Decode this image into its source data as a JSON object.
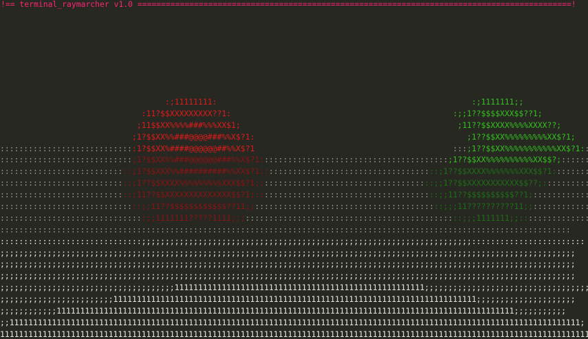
{
  "window": {
    "title": "!== terminal_raymarcher v1.0 ============================================================================================!"
  },
  "colors": {
    "background": "#272822",
    "title": "#f92672",
    "red_sphere": "#e01b1b",
    "red_sphere_dark": "#8a1414",
    "green_sphere": "#34c21e",
    "green_sphere_dark": "#1f6f16",
    "floor": "#e8e8e0",
    "floor_dim": "#9a9a90"
  },
  "frame": {
    "rows": [
      [
        {
          "t": "                                   :;11111111:",
          "c": "red_sphere"
        },
        {
          "t": "                                                      :;1111111;;",
          "c": "green_sphere"
        }
      ],
      [
        {
          "t": "                              :11?$$XXXXXXXXX??1:",
          "c": "red_sphere"
        },
        {
          "t": "                                               :;;1??$$$$XXX$$??1;",
          "c": "green_sphere"
        }
      ],
      [
        {
          "t": "                             ;11$$XX%%%%###%%%XX$1;",
          "c": "red_sphere"
        },
        {
          "t": "                                              ;11??$$XXXX%%%%XXXX??;",
          "c": "green_sphere"
        }
      ],
      [
        {
          "t": "                            ;1?$$XX%%###@@@@###%%X$?1:",
          "c": "red_sphere"
        },
        {
          "t": "                                             ;1??$$XX%%%%%%%%%XX$?1;",
          "c": "green_sphere"
        }
      ],
      [
        {
          "t": "::::::::::::::::::::::::::::",
          "c": "floor_dim"
        },
        {
          "t": ":1?$$XX%####@@@@@@##%%X$?1",
          "c": "red_sphere"
        },
        {
          "t": "                                          :::",
          "c": "floor_dim"
        },
        {
          "t": ";1??$$XX%%%%%%%%%%%XX$?1:",
          "c": "green_sphere"
        },
        {
          "t": ":::::::::::::::::::::::",
          "c": "floor_dim"
        }
      ],
      [
        {
          "t": "::::::::::::::::::::::::::::",
          "c": "floor_dim"
        },
        {
          "t": ";1?$$XX%%###@@@@@@###%%X$?1:",
          "c": "red_sphere_dark"
        },
        {
          "t": ":::::::::::::::::::::::::::::::::::::::",
          "c": "floor_dim"
        },
        {
          "t": ";1??$$XX%%%%%%%%%%XX$$?;",
          "c": "green_sphere"
        },
        {
          "t": "::::::::::::::::::::::::",
          "c": "floor_dim"
        }
      ],
      [
        {
          "t": "::::::::::::::::::::::::::",
          "c": "floor_dim"
        },
        {
          "t": "::;1?$$XXX%%##########%%XX$?1::",
          "c": "red_sphere_dark"
        },
        {
          "t": "::::::::::::::::::::::::::::::::::",
          "c": "floor_dim"
        },
        {
          "t": "::;1??$$XXXX%%%%%%%XXX$$?1:",
          "c": "green_sphere_dark"
        },
        {
          "t": "::::::::::::::::::::::::",
          "c": "floor_dim"
        }
      ],
      [
        {
          "t": "::::::::::::::::::::::::::",
          "c": "floor_dim"
        },
        {
          "t": "::;1??$$XXXX%%%%%%%%%XXX$$?1;:",
          "c": "red_sphere_dark"
        },
        {
          "t": "::::::::::::::::::::::::::::::::::",
          "c": "floor_dim"
        },
        {
          "t": "::;;1??$$XXXXXXXXXXX$$??;:",
          "c": "green_sphere_dark"
        },
        {
          "t": ":::::::::::::::::::::::::",
          "c": "floor_dim"
        }
      ],
      [
        {
          "t": "::::::::::::::::::::::::::",
          "c": "floor_dim"
        },
        {
          "t": "::;11??$$XXXXXXXXXXXXXX$$?1;::",
          "c": "red_sphere_dark"
        },
        {
          "t": ":::::::::::::::::::::::::::::::::::",
          "c": "floor_dim"
        },
        {
          "t": "::;;11??$$$$$$$$$$??1;",
          "c": "green_sphere_dark"
        },
        {
          "t": "::::::::::::::::::::::::::::",
          "c": "floor_dim"
        }
      ],
      [
        {
          "t": "::::::::::::::::::::::::::::",
          "c": "floor_dim"
        },
        {
          "t": "::;;11??$$$$$$$$$$$$??11;;",
          "c": "red_sphere_dark"
        },
        {
          "t": "::::::::::::::::::::::::::::::::::::::",
          "c": "floor_dim"
        },
        {
          "t": "::;;;11??????????11;;",
          "c": "green_sphere_dark"
        },
        {
          "t": "::::::::::::::::::::::::::::::",
          "c": "floor_dim"
        }
      ],
      [
        {
          "t": "::::::::::::::::::::::::::::::",
          "c": "floor_dim"
        },
        {
          "t": ":;;1111111?????1111;;;",
          "c": "red_sphere_dark"
        },
        {
          "t": "::::::::::::::::::::::::::::::::::::::::::::",
          "c": "floor_dim"
        },
        {
          "t": "::;;;1111111;;::",
          "c": "green_sphere_dark"
        },
        {
          "t": "::::::::::::::::::::::::::::::::::",
          "c": "floor_dim"
        }
      ],
      [
        {
          "t": ":::::::::::::::::::::::::::::::::::::::::::::::::::::::::::::::::::::::::::::::::::::::::::::::::::::::::::::::::::::::::",
          "c": "floor_dim"
        }
      ],
      [
        {
          "t": "::::::::::::::::::::::::::::::;;;;;;;;;;;;;;;;;;;;;;;;;;;;;;;;;;;;;;;;;;;;;;;;;;;;;;;;;;;;;;;;;;;;;;::::::::::::::::::::::::",
          "c": "floor"
        }
      ],
      [
        {
          "t": ";;;;;;;;;;;;;;;;;;;;;;;;;;;;;;;;;;;;;;;;;;;;;;;;;;;;;;;;;;;;;;;;;;;;;;;;;;;;;;;;;;;;;;;;;;;;;;;;;;;;;;;;;;;;;;;;;;;;;;;;;;",
          "c": "floor"
        }
      ],
      [
        {
          "t": ";;;;;;;;;;;;;;;;;;;;;;;;;;;;;;;;;;;;;;;;;;;;;;;;;;;;;;;;;;;;;;;;;;;;;;;;;;;;;;;;;;;;;;;;;;;;;;;;;;;;;;;;;;;;;;;;;;;;;;;;;;",
          "c": "floor"
        }
      ],
      [
        {
          "t": ";;;;;;;;;;;;;;;;;;;;;;;;;;;;;;;;;;;;;;;;;;;;;;;;;;;;;;;;;;;;;;;;;;;;;;;;;;;;;;;;;;;;;;;;;;;;;;;;;;;;;;;;;;;;;;;;;;;;;;;;;;",
          "c": "floor"
        }
      ],
      [
        {
          "t": ";;;;;;;;;;;;;;;;;;;;;;;;;;;;;;;;;;;;;11111111111111111111111111111111111111111111111111111;;;;;;;;;;;;;;;;;;;;;;;;;;;;;;;;;;;;",
          "c": "floor"
        }
      ],
      [
        {
          "t": ";;;;;;;;;;;;;;;;;;;;;;;;11111111111111111111111111111111111111111111111111111111111111111111111111111;;;;;;;;;;;;;;;;;;;;;",
          "c": "floor"
        }
      ],
      [
        {
          "t": ";;;;;;;;;;;;1111111111111111111111111111111111111111111111111111111111111111111111111111111111111111111111111;;;;;;;;;;;",
          "c": "floor"
        }
      ],
      [
        {
          "t": ";;1111111111111111111111111111111111111111111111111111111111111111111111111111111111111111111111111111111111111111111111111;",
          "c": "floor"
        }
      ],
      [
        {
          "t": "11111111111111111111111111111111111111111111111111111111111111111111111111111111111111111111111111111111111111111111111111111",
          "c": "floor"
        }
      ]
    ]
  }
}
